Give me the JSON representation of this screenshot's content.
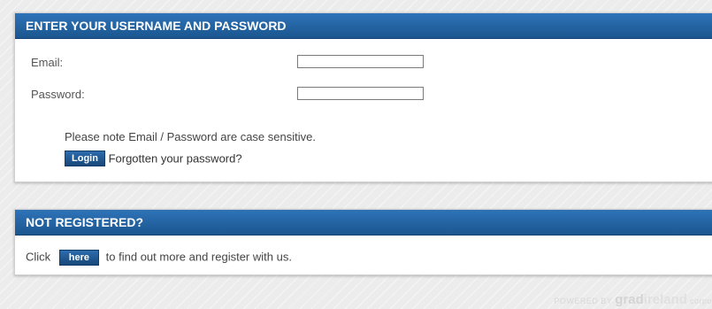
{
  "login": {
    "header": "ENTER YOUR USERNAME AND PASSWORD",
    "email_label": "Email:",
    "email_value": "",
    "password_label": "Password:",
    "password_value": "",
    "note": "Please note Email / Password are case sensitive.",
    "login_button": "Login",
    "forgot_link": "Forgotten your password?"
  },
  "register": {
    "header": "NOT REGISTERED?",
    "prefix": "Click",
    "here_button": "here",
    "suffix": "to find out more and register with us."
  },
  "footer": {
    "powered_by": "POWERED BY",
    "brand_part1": "grad",
    "brand_part2": "ireland",
    "brand_tail": "corpo"
  },
  "colors": {
    "header_bg": "#1f5f9e",
    "background": "#ececec"
  }
}
